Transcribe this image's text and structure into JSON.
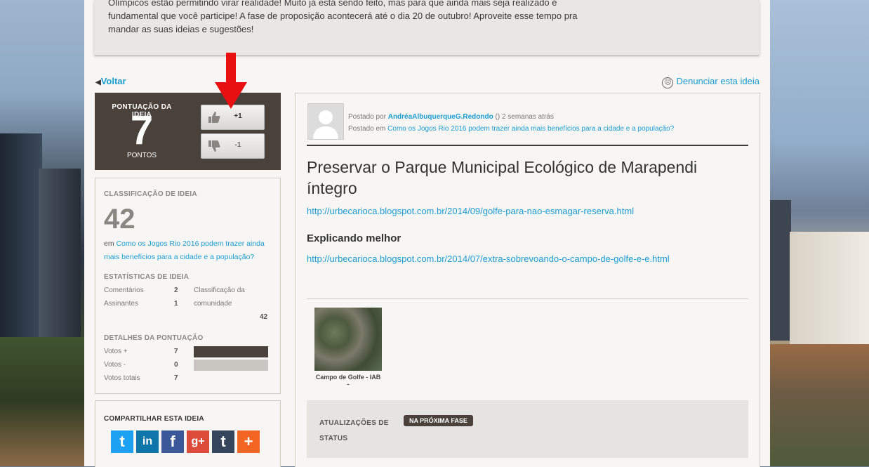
{
  "banner": {
    "text": "Olímpicos estão permitindo virar realidade! Muito já está sendo feito, mas para que ainda mais seja realizado é fundamental que você participe! A fase de proposição acontecerá até o dia 20 de outubro! Aproveite esse tempo pra mandar as suas ideias e sugestões!"
  },
  "nav": {
    "back_label": "Voltar",
    "report_label": "Denunciar esta ideia"
  },
  "score": {
    "label": "PONTUAÇÃO DA IDEIA",
    "value": "7",
    "unit": "PONTOS",
    "up_label": "+1",
    "down_label": "-1"
  },
  "classification": {
    "heading": "CLASSIFICAÇÃO DE IDEIA",
    "rank": "42",
    "in_prefix": "em",
    "in_link": "Como os Jogos Rio 2016 podem trazer ainda mais benefícios para a cidade e a população?",
    "stats_heading": "ESTATÍSTICAS DE IDEIA",
    "comments_label": "Comentários",
    "comments_value": "2",
    "subscribers_label": "Assinantes",
    "subscribers_value": "1",
    "community_label_1": "Classificação da",
    "community_label_2": "comunidade",
    "community_value": "42",
    "details_heading": "DETALHES DA PONTUAÇÃO",
    "votes_plus_label": "Votos +",
    "votes_plus_value": "7",
    "votes_minus_label": "Votos -",
    "votes_minus_value": "0",
    "votes_total_label": "Votos totais",
    "votes_total_value": "7",
    "plus_fraction": 1.0,
    "minus_fraction": 0.0,
    "plus_color": "#4a413b",
    "minus_color": "#c9c5c1"
  },
  "share": {
    "heading": "COMPARTILHAR ESTA IDEIA",
    "buttons": [
      {
        "name": "twitter",
        "glyph": "t",
        "color": "#1da1f2"
      },
      {
        "name": "linkedin",
        "glyph": "in",
        "color": "#0e76a8"
      },
      {
        "name": "facebook",
        "glyph": "f",
        "color": "#3b5998"
      },
      {
        "name": "google-plus",
        "glyph": "g+",
        "color": "#dd4b39"
      },
      {
        "name": "tumblr",
        "glyph": "t",
        "color": "#35465c"
      },
      {
        "name": "more",
        "glyph": "+",
        "color": "#f26522"
      }
    ]
  },
  "post": {
    "posted_by_prefix": "Postado por",
    "author": "AndréaAlbuquerqueG.Redondo",
    "posted_by_suffix": "() 2 semanas atrás",
    "posted_in_prefix": "Postado em",
    "posted_in_link": "Como os Jogos Rio 2016 podem trazer ainda mais benefícios para a cidade e a população?",
    "title": "Preservar o Parque Municipal Ecológico de Marapendi íntegro",
    "link1": "http://urbecarioca.blogspot.com.br/2014/09/golfe-para-nao-esmagar-reserva.html",
    "subheading": "Explicando melhor",
    "link2": "http://urbecarioca.blogspot.com.br/2014/07/extra-sobrevoando-o-campo-de-golfe-e-e.html",
    "attachment_caption": "Campo de Golfe - IAB -",
    "status_label": "ATUALIZAÇÕES DE STATUS",
    "status_badge": "NA PRÓXIMA FASE"
  }
}
